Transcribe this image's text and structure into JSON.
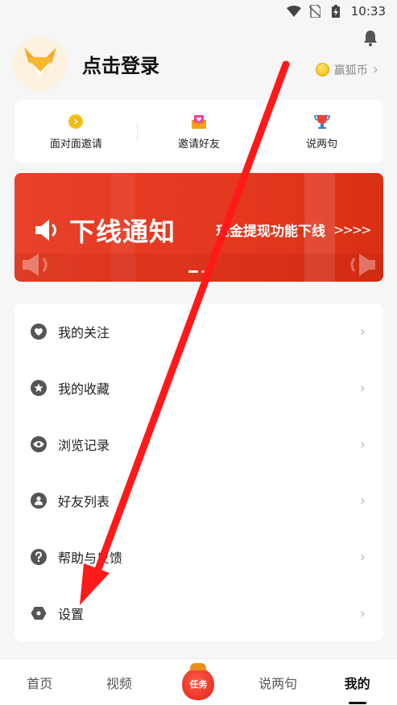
{
  "status_bar": {
    "time": "10:33"
  },
  "profile": {
    "login_label": "点击登录",
    "coin_label": "赢狐币"
  },
  "quick_actions": [
    {
      "label": "面对面邀请",
      "icon": "coin-icon"
    },
    {
      "label": "邀请好友",
      "icon": "envelope-heart-icon"
    },
    {
      "label": "说两句",
      "icon": "trophy-icon"
    }
  ],
  "banner": {
    "title": "下线通知",
    "subtitle": "现金提现功能下线",
    "arrows": ">>>>"
  },
  "menu": [
    {
      "label": "我的关注",
      "icon": "heart-icon"
    },
    {
      "label": "我的收藏",
      "icon": "star-icon"
    },
    {
      "label": "浏览记录",
      "icon": "eye-icon"
    },
    {
      "label": "好友列表",
      "icon": "person-icon"
    },
    {
      "label": "帮助与反馈",
      "icon": "question-icon"
    },
    {
      "label": "设置",
      "icon": "hexagon-icon"
    }
  ],
  "bottom_nav": [
    {
      "label": "首页"
    },
    {
      "label": "视频"
    },
    {
      "label": "任务"
    },
    {
      "label": "说两句"
    },
    {
      "label": "我的",
      "active": true
    }
  ],
  "colors": {
    "banner_red": "#e53a22",
    "annotation_arrow": "#ff1a1a",
    "coin_gold": "#f2b705"
  }
}
